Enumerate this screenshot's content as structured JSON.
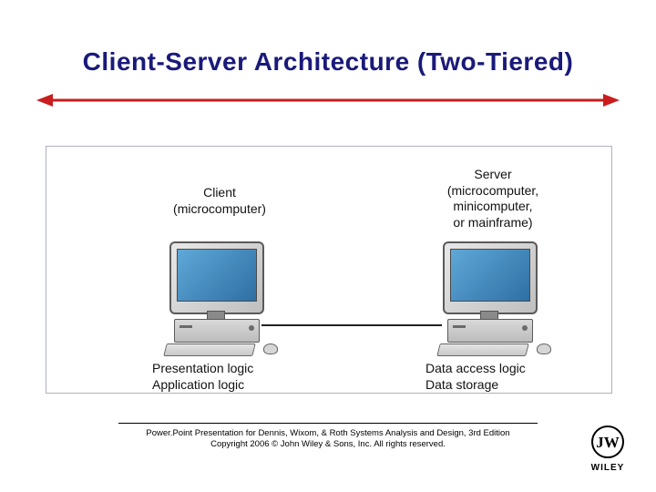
{
  "title": "Client-Server Architecture (Two-Tiered)",
  "client": {
    "caption_line1": "Client",
    "caption_line2": "(microcomputer)",
    "logic_line1": "Presentation logic",
    "logic_line2": "Application logic"
  },
  "server": {
    "caption_line1": "Server",
    "caption_line2": "(microcomputer,",
    "caption_line3": "minicomputer,",
    "caption_line4": "or mainframe)",
    "logic_line1": "Data access logic",
    "logic_line2": "Data storage"
  },
  "footer": {
    "line1": "Power.Point Presentation for Dennis, Wixom, & Roth Systems Analysis and Design, 3rd Edition",
    "line2": "Copyright 2006 © John Wiley & Sons, Inc.  All rights reserved."
  },
  "brand": {
    "name": "WILEY"
  },
  "colors": {
    "title": "#1a1a7a",
    "arrow": "#c91d1d",
    "frame": "#aeb0c0"
  }
}
